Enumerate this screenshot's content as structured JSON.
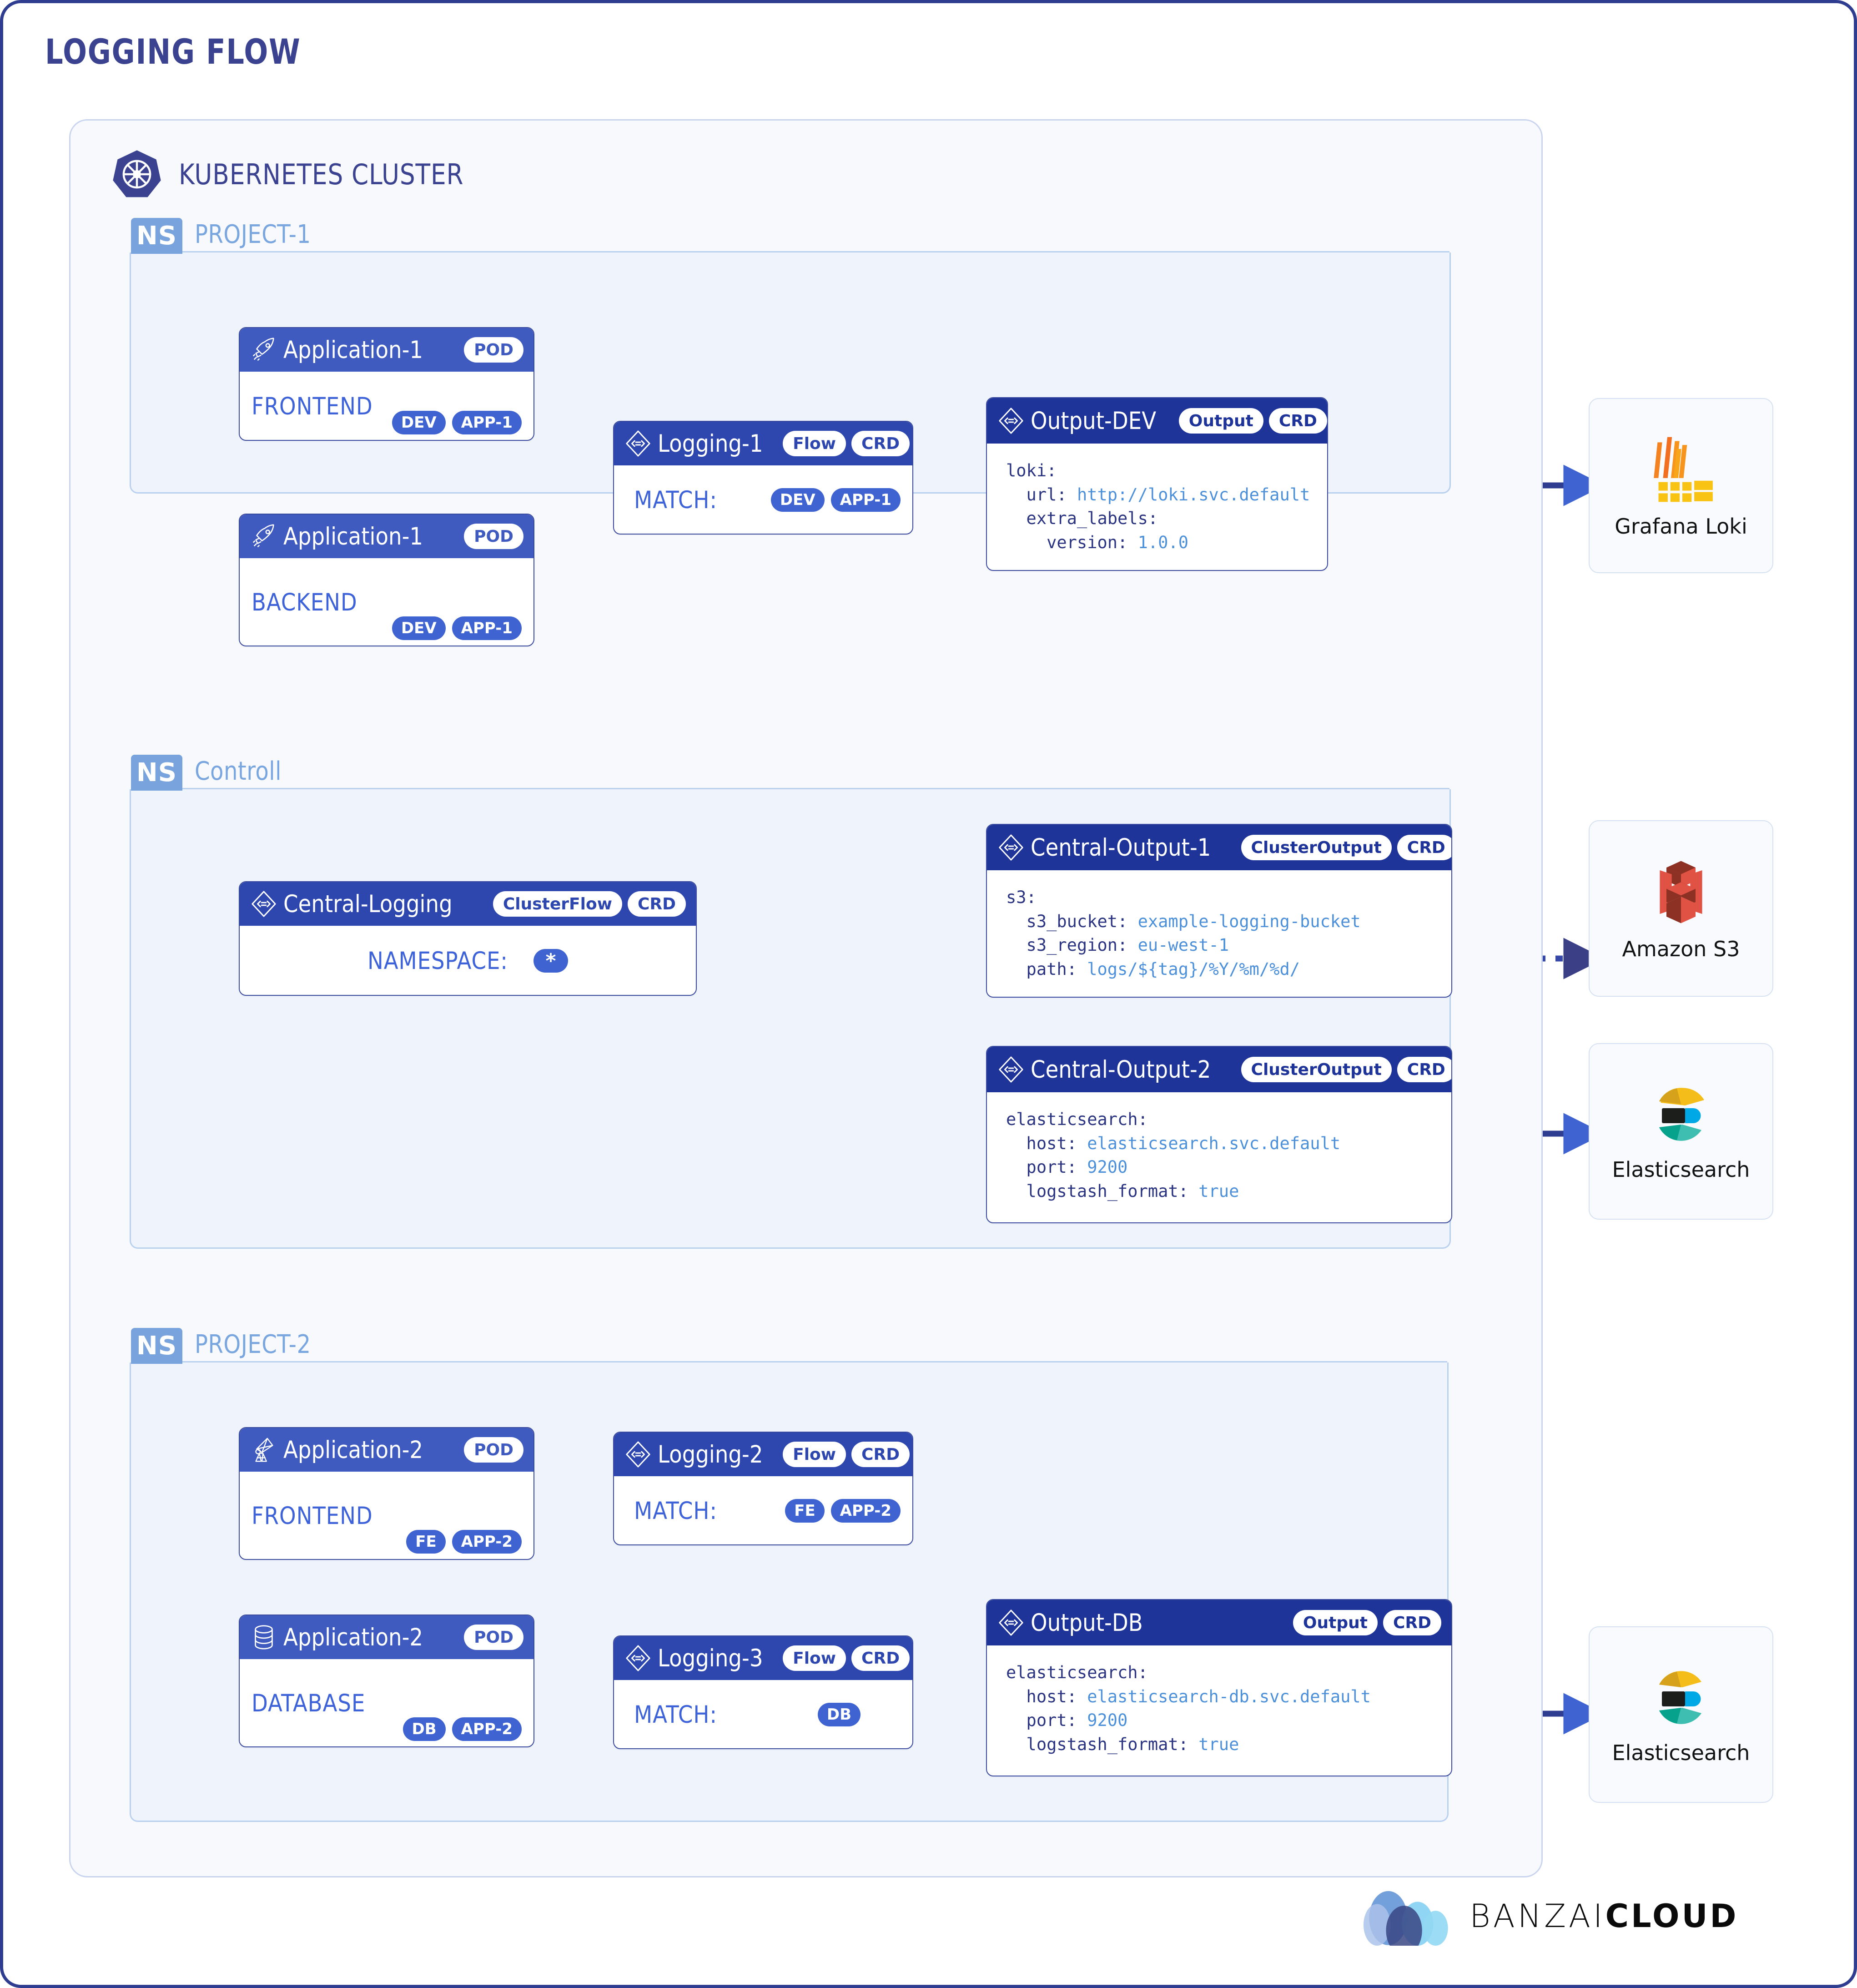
{
  "page": {
    "title": "LOGGING FLOW",
    "cluster_title": "KUBERNETES CLUSTER",
    "ns_tag": "NS",
    "brand_light": "BANZAI",
    "brand_bold": "CLOUD"
  },
  "namespaces": [
    {
      "name": "PROJECT-1"
    },
    {
      "name": "Controll"
    },
    {
      "name": "PROJECT-2"
    }
  ],
  "cards": {
    "app1_frontend": {
      "title": "Application-1",
      "kind": "POD",
      "body_label": "FRONTEND",
      "tags": [
        "DEV",
        "APP-1"
      ],
      "icon": "rocket-icon"
    },
    "app1_backend": {
      "title": "Application-1",
      "kind": "POD",
      "body_label": "BACKEND",
      "tags": [
        "DEV",
        "APP-1"
      ],
      "icon": "rocket-icon"
    },
    "logging1": {
      "title": "Logging-1",
      "kind": "Flow",
      "crd": "CRD",
      "body_label": "MATCH:",
      "tags": [
        "DEV",
        "APP-1"
      ],
      "icon": "crd-diamond-icon"
    },
    "output_dev": {
      "title": "Output-DEV",
      "kind": "Output",
      "crd": "CRD",
      "icon": "crd-diamond-icon",
      "yaml": [
        {
          "key": "loki:",
          "indent": 0
        },
        {
          "key": "url:",
          "value": "http://loki.svc.default",
          "indent": 1
        },
        {
          "key": "extra_labels:",
          "indent": 1
        },
        {
          "key": "version:",
          "value": "1.0.0",
          "indent": 2
        }
      ]
    },
    "central_logging": {
      "title": "Central-Logging",
      "kind": "ClusterFlow",
      "crd": "CRD",
      "body_label": "NAMESPACE:",
      "tags": [
        "*"
      ],
      "icon": "crd-diamond-icon"
    },
    "central_output_1": {
      "title": "Central-Output-1",
      "kind": "ClusterOutput",
      "crd": "CRD",
      "icon": "crd-diamond-icon",
      "yaml": [
        {
          "key": "s3:",
          "indent": 0
        },
        {
          "key": "s3_bucket:",
          "value": "example-logging-bucket",
          "indent": 1
        },
        {
          "key": "s3_region:",
          "value": "eu-west-1",
          "indent": 1
        },
        {
          "key": "path:",
          "value": "logs/${tag}/%Y/%m/%d/",
          "indent": 1
        }
      ]
    },
    "central_output_2": {
      "title": "Central-Output-2",
      "kind": "ClusterOutput",
      "crd": "CRD",
      "icon": "crd-diamond-icon",
      "yaml": [
        {
          "key": "elasticsearch:",
          "indent": 0
        },
        {
          "key": "host:",
          "value": "elasticsearch.svc.default",
          "indent": 1
        },
        {
          "key": "port:",
          "value": "9200",
          "indent": 1
        },
        {
          "key": "logstash_format:",
          "value": "true",
          "indent": 1
        }
      ]
    },
    "app2_frontend": {
      "title": "Application-2",
      "kind": "POD",
      "body_label": "FRONTEND",
      "tags": [
        "FE",
        "APP-2"
      ],
      "icon": "satellite-icon"
    },
    "logging2": {
      "title": "Logging-2",
      "kind": "Flow",
      "crd": "CRD",
      "body_label": "MATCH:",
      "tags": [
        "FE",
        "APP-2"
      ],
      "icon": "crd-diamond-icon"
    },
    "app2_database": {
      "title": "Application-2",
      "kind": "POD",
      "body_label": "DATABASE",
      "tags": [
        "DB",
        "APP-2"
      ],
      "icon": "database-icon"
    },
    "logging3": {
      "title": "Logging-3",
      "kind": "Flow",
      "crd": "CRD",
      "body_label": "MATCH:",
      "tags": [
        "DB"
      ],
      "icon": "crd-diamond-icon"
    },
    "output_db": {
      "title": "Output-DB",
      "kind": "Output",
      "crd": "CRD",
      "icon": "crd-diamond-icon",
      "yaml": [
        {
          "key": "elasticsearch:",
          "indent": 0
        },
        {
          "key": "host:",
          "value": "elasticsearch-db.svc.default",
          "indent": 1
        },
        {
          "key": "port:",
          "value": "9200",
          "indent": 1
        },
        {
          "key": "logstash_format:",
          "value": "true",
          "indent": 1
        }
      ]
    }
  },
  "destinations": [
    {
      "label": "Grafana Loki",
      "icon": "grafana-loki-logo"
    },
    {
      "label": "Amazon S3",
      "icon": "amazon-s3-logo"
    },
    {
      "label": "Elasticsearch",
      "icon": "elasticsearch-logo"
    },
    {
      "label": "Elasticsearch",
      "icon": "elasticsearch-logo"
    }
  ],
  "colors": {
    "frame_border": "#2e3d8f",
    "title": "#3b4391",
    "ns_tag": "#79a3dd",
    "ns_fill": "#eef3fc",
    "app_header": "#3f5bbf",
    "flow_header": "#2e47ae",
    "output_header": "#1e3499",
    "pill_blue": "#3f63d0",
    "wire_solid": "#3f63d0",
    "wire_dotted": "#3a3f86",
    "yaml_key": "#2a3480",
    "yaml_value": "#4d90da"
  }
}
